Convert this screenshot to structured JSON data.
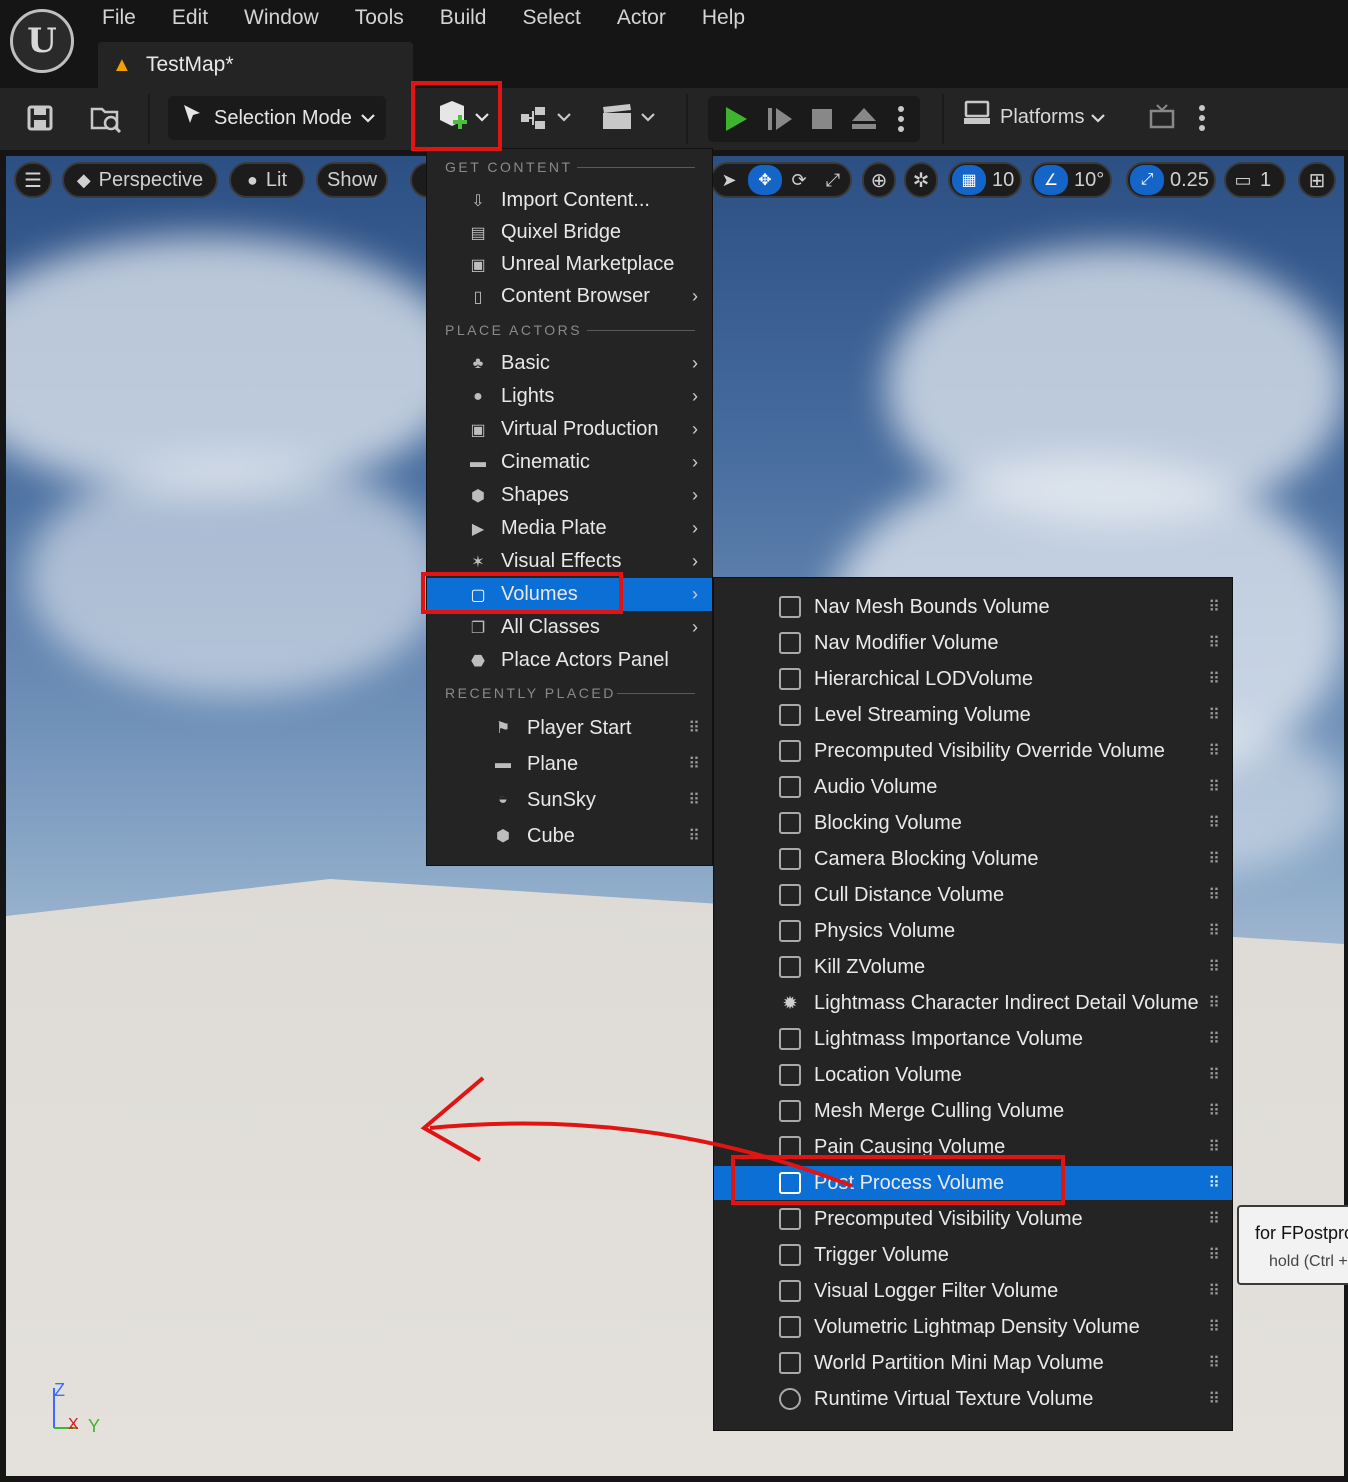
{
  "menubar": {
    "items": [
      "File",
      "Edit",
      "Window",
      "Tools",
      "Build",
      "Select",
      "Actor",
      "Help"
    ]
  },
  "tab": {
    "label": "TestMap*"
  },
  "toolbar": {
    "selection_mode": "Selection Mode",
    "platforms": "Platforms"
  },
  "viewport_toolbar": {
    "perspective": "Perspective",
    "lit": "Lit",
    "show": "Show",
    "grid_snap": "10",
    "rotation_snap": "10°",
    "scale_snap": "0.25",
    "camera_speed": "1"
  },
  "place_menu": {
    "get_content_header": "GET CONTENT",
    "get_content": [
      {
        "label": "Import Content...",
        "icon": "import-icon"
      },
      {
        "label": "Quixel Bridge",
        "icon": "bridge-icon"
      },
      {
        "label": "Unreal Marketplace",
        "icon": "marketplace-icon"
      },
      {
        "label": "Content Browser",
        "icon": "content-browser-icon"
      }
    ],
    "place_actors_header": "PLACE ACTORS",
    "place_actors": [
      {
        "label": "Basic",
        "icon": "basic-icon"
      },
      {
        "label": "Lights",
        "icon": "light-bulb-icon"
      },
      {
        "label": "Virtual Production",
        "icon": "virtual-production-icon"
      },
      {
        "label": "Cinematic",
        "icon": "clapper-icon"
      },
      {
        "label": "Shapes",
        "icon": "shapes-icon"
      },
      {
        "label": "Media Plate",
        "icon": "media-plate-icon"
      },
      {
        "label": "Visual Effects",
        "icon": "sparkle-icon"
      },
      {
        "label": "Volumes",
        "icon": "volume-icon"
      },
      {
        "label": "All Classes",
        "icon": "all-classes-icon"
      },
      {
        "label": "Place Actors Panel",
        "icon": "place-actors-icon"
      }
    ],
    "recently_placed_header": "RECENTLY PLACED",
    "recently_placed": [
      {
        "label": "Player Start",
        "icon": "player-start-icon"
      },
      {
        "label": "Plane",
        "icon": "plane-icon"
      },
      {
        "label": "SunSky",
        "icon": "sunsky-icon"
      },
      {
        "label": "Cube",
        "icon": "cube-icon"
      }
    ]
  },
  "volumes_menu": {
    "items": [
      "Nav Mesh Bounds Volume",
      "Nav Modifier Volume",
      "Hierarchical LODVolume",
      "Level Streaming Volume",
      "Precomputed Visibility Override Volume",
      "Audio Volume",
      "Blocking Volume",
      "Camera Blocking Volume",
      "Cull Distance Volume",
      "Physics Volume",
      "Kill ZVolume",
      "Lightmass Character Indirect Detail Volume",
      "Lightmass Importance Volume",
      "Location Volume",
      "Mesh Merge Culling Volume",
      "Pain Causing Volume",
      "Post Process Volume",
      "Precomputed Visibility Volume",
      "Trigger Volume",
      "Visual Logger Filter Volume",
      "Volumetric Lightmap Density Volume",
      "World Partition Mini Map Volume",
      "Runtime Virtual Texture Volume"
    ],
    "selected": "Post Process Volume"
  },
  "tooltip": {
    "line1": "for FPostpro",
    "line2": "hold (Ctrl +"
  },
  "axis": {
    "z": "Z",
    "x": "X",
    "y": "Y"
  },
  "colors": {
    "selection_blue": "#0b6fd6",
    "annotation_red": "#e11414",
    "play_green": "#3fb52f"
  }
}
